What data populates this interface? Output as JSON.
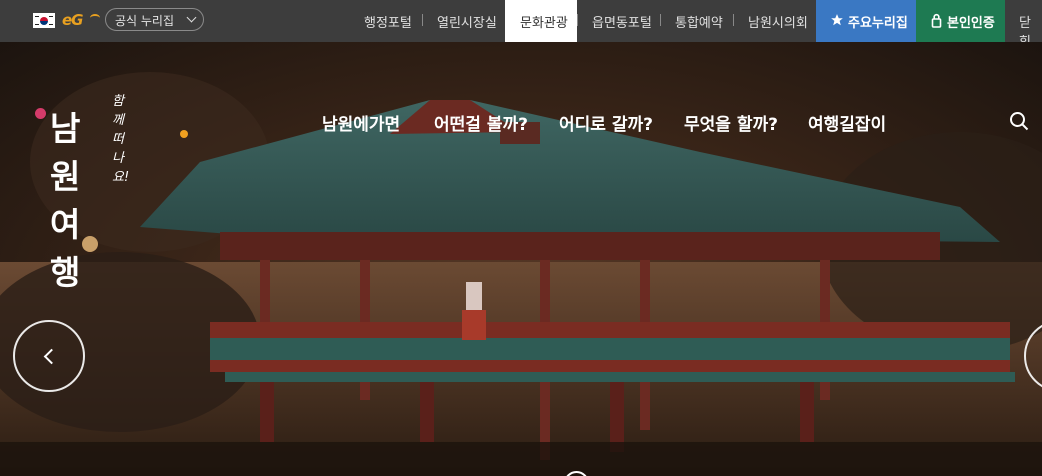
{
  "topbar": {
    "official_select": "공식 누리집",
    "links": [
      "행정포털",
      "열린시장실",
      "문화관광",
      "읍면동포털",
      "통합예약",
      "남원시의회"
    ],
    "active_link": "문화관광",
    "main_sites_label": "주요누리집",
    "auth_label": "본인인증",
    "close_label": "닫힘",
    "eg_logo": "eG",
    "colors": {
      "topbar_bg": "#3d3d3d",
      "main_btn": "#3a78c3",
      "auth_btn": "#1e7a52"
    }
  },
  "logo": {
    "tagline": "함께 떠나요!",
    "title": "남원여행"
  },
  "nav": {
    "items": [
      "남원에가면",
      "어떤걸 볼까?",
      "어디로 갈까?",
      "무엇을 할까?",
      "여행길잡이"
    ]
  },
  "icons": [
    "flag-icon",
    "search-icon",
    "star-icon",
    "lock-icon",
    "chevron-left-icon",
    "pause-icon"
  ],
  "slider": {
    "total_slides": 2,
    "current_slide": 1
  }
}
